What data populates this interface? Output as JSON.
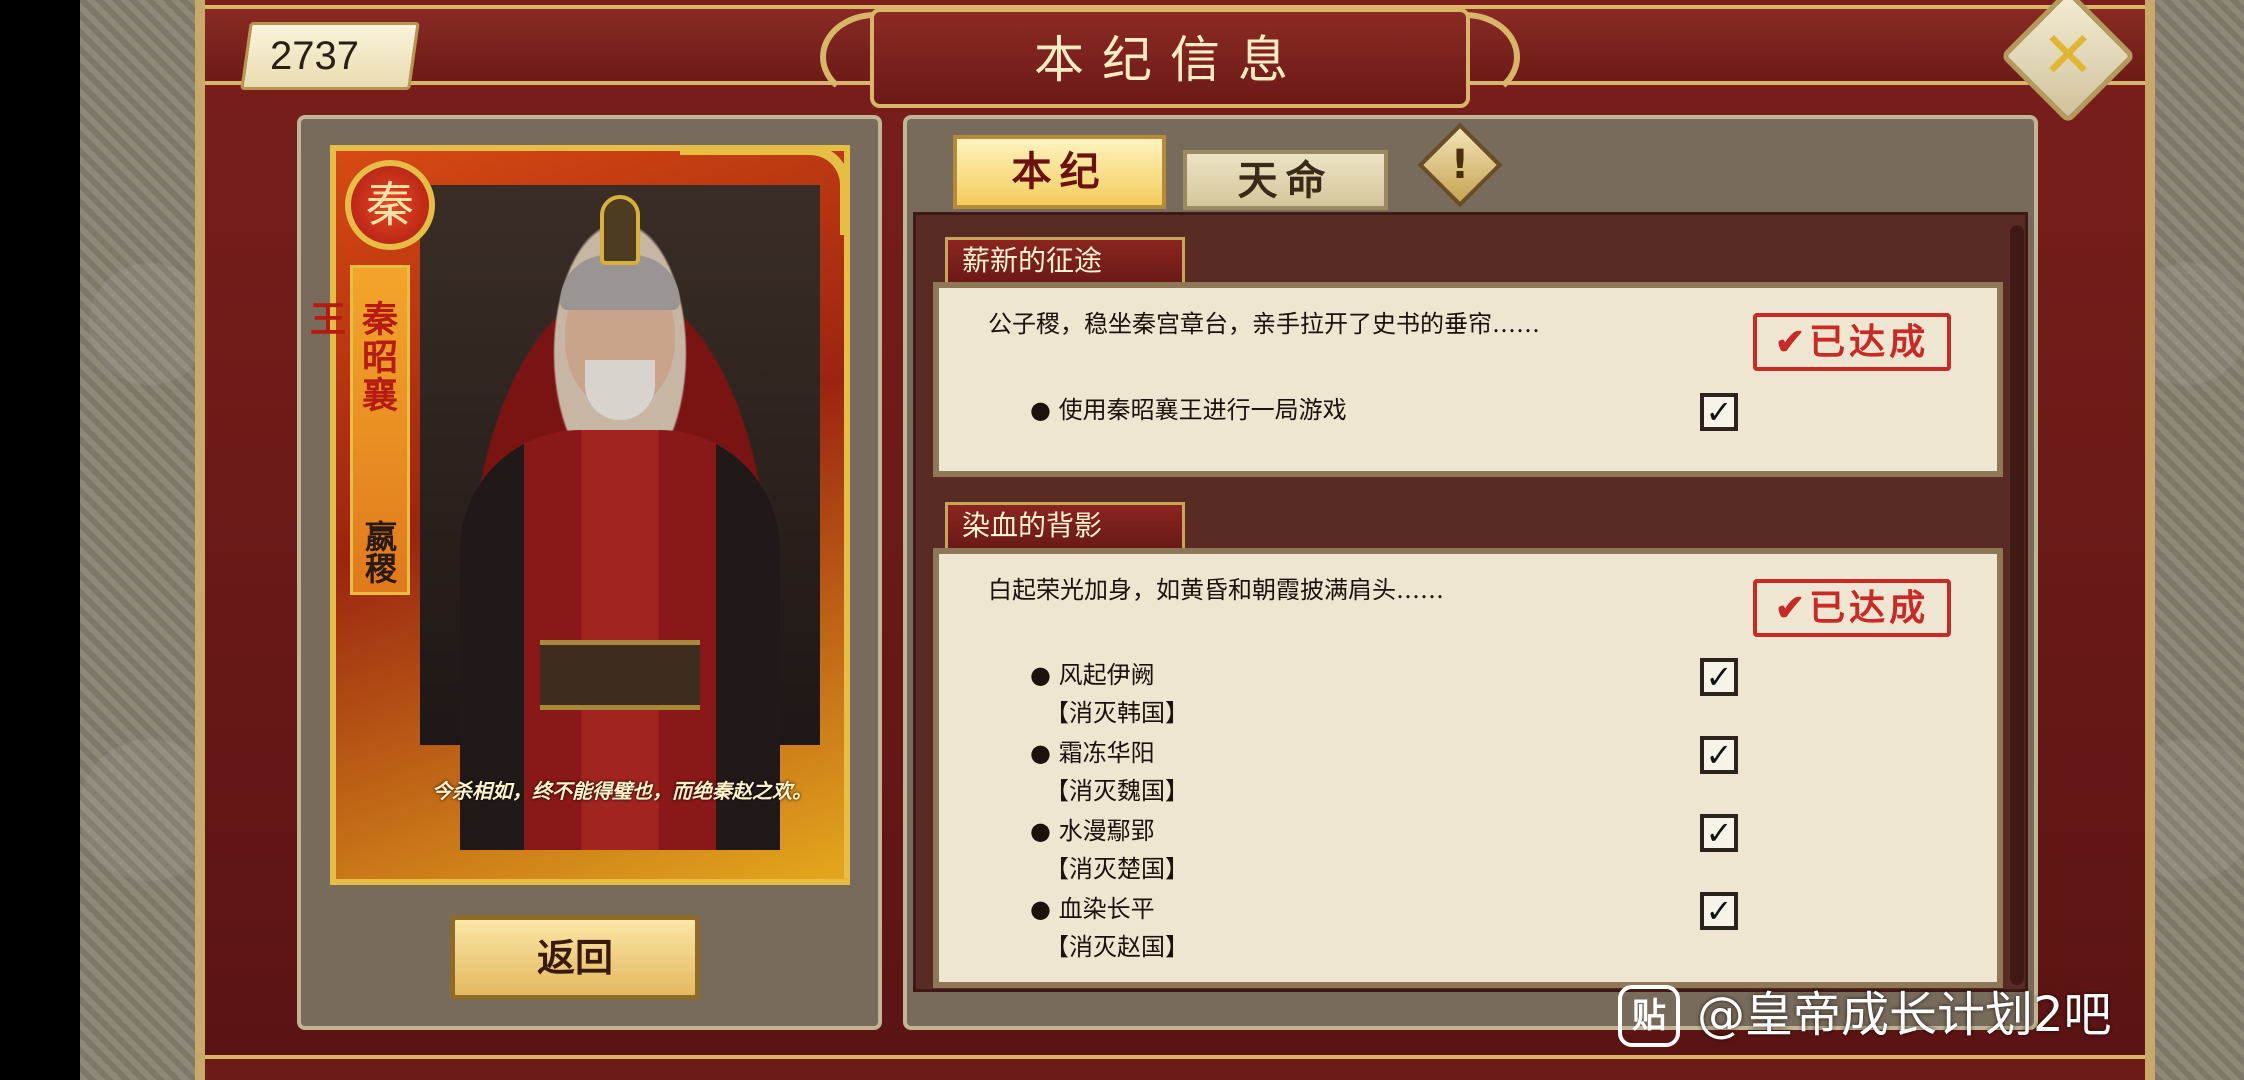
{
  "currency": {
    "value": "2737"
  },
  "title": "本纪信息",
  "card": {
    "emblem": "秦",
    "name": "秦昭襄王",
    "given_name": "嬴稷",
    "quote": "今杀相如，终不能得璧也，而绝秦赵之欢。"
  },
  "buttons": {
    "return": "返回",
    "close_icon": "close-x-icon",
    "alert_icon": "exclamation-icon"
  },
  "tabs": [
    {
      "label": "本纪",
      "active": true
    },
    {
      "label": "天命",
      "active": false
    }
  ],
  "sections": [
    {
      "title": "薪新的征途",
      "desc": "公子稷，稳坐秦宫章台，亲手拉开了史书的垂帘……",
      "stamp": "✔已达成",
      "tasks": [
        {
          "label": "● 使用秦昭襄王进行一局游戏",
          "checked": true
        }
      ]
    },
    {
      "title": "染血的背影",
      "desc": "白起荣光加身，如黄昏和朝霞披满肩头……",
      "stamp": "✔已达成",
      "tasks": [
        {
          "label": "● 风起伊阙",
          "sub": "【消灭韩国】",
          "checked": true
        },
        {
          "label": "● 霜冻华阳",
          "sub": "【消灭魏国】",
          "checked": true
        },
        {
          "label": "● 水漫鄢郢",
          "sub": "【消灭楚国】",
          "checked": true
        },
        {
          "label": "● 血染长平",
          "sub": "【消灭赵国】",
          "checked": true
        }
      ]
    }
  ],
  "check_glyph": "✓",
  "watermark": {
    "icon": "贴",
    "text": "@皇帝成长计划2吧"
  },
  "colors": {
    "frame_red": "#7a1f1c",
    "gold": "#d9b56a",
    "stamp_red": "#c82a26"
  }
}
